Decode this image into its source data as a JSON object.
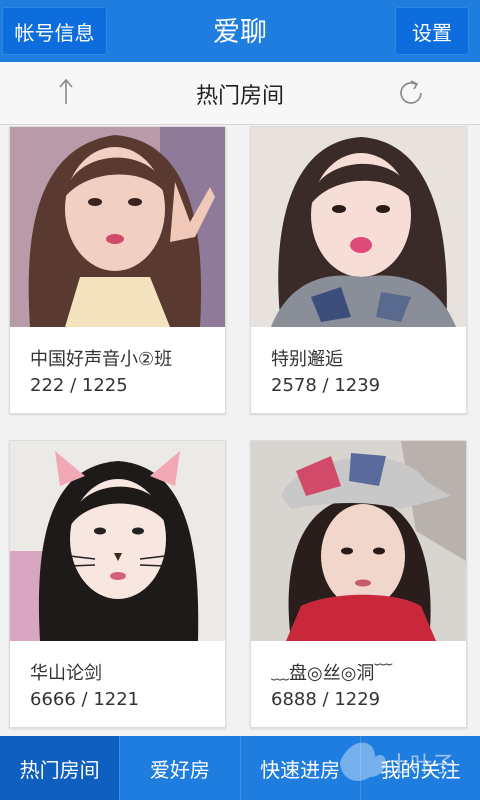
{
  "header": {
    "title": "爱聊",
    "left_button": "帐号信息",
    "right_button": "设置"
  },
  "subheader": {
    "title": "热门房间",
    "left_icon": "arrow-up-icon",
    "right_icon": "refresh-icon"
  },
  "rooms": [
    {
      "name": "中国好声音小②班",
      "stats": "222 / 1225"
    },
    {
      "name": "特别邂逅",
      "stats": "2578 / 1239"
    },
    {
      "name": "华山论剑",
      "stats": "6666 / 1221"
    },
    {
      "name": "﹏盘◎丝◎洞﹋",
      "stats": "6888 / 1229"
    }
  ],
  "tabs": [
    {
      "label": "热门房间",
      "active": true
    },
    {
      "label": "爱好房",
      "active": false
    },
    {
      "label": "快速进房",
      "active": false
    },
    {
      "label": "我的关注",
      "active": false
    }
  ],
  "watermark": "土叶子",
  "colors": {
    "primary": "#1f7de0",
    "active_tab": "#0f5fc0",
    "button": "#0d6ddc"
  }
}
